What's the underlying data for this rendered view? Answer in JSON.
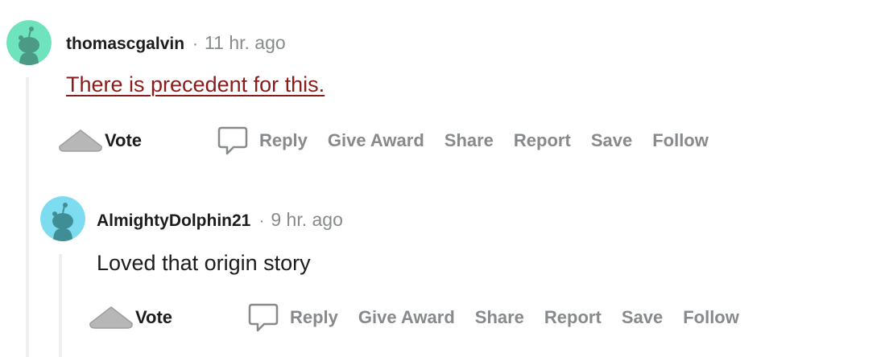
{
  "colors": {
    "avatar_1": "#6fe3bd",
    "avatar_2": "#7ddcef",
    "link": "#8b1a1a",
    "meta_gray": "#878a8c",
    "thread_line": "#edeff1"
  },
  "comments": [
    {
      "username": "thomascgalvin",
      "separator": "·",
      "timestamp": "11 hr. ago",
      "body": "There is precedent for this.",
      "body_is_link": true,
      "avatar_icon": "snoo-avatar-icon",
      "actions": {
        "vote": "Vote",
        "reply": "Reply",
        "give_award": "Give Award",
        "share": "Share",
        "report": "Report",
        "save": "Save",
        "follow": "Follow"
      }
    },
    {
      "username": "AlmightyDolphin21",
      "separator": "·",
      "timestamp": "9 hr. ago",
      "body": "Loved that origin story",
      "body_is_link": false,
      "avatar_icon": "snoo-avatar-icon",
      "actions": {
        "vote": "Vote",
        "reply": "Reply",
        "give_award": "Give Award",
        "share": "Share",
        "report": "Report",
        "save": "Save",
        "follow": "Follow"
      }
    }
  ]
}
